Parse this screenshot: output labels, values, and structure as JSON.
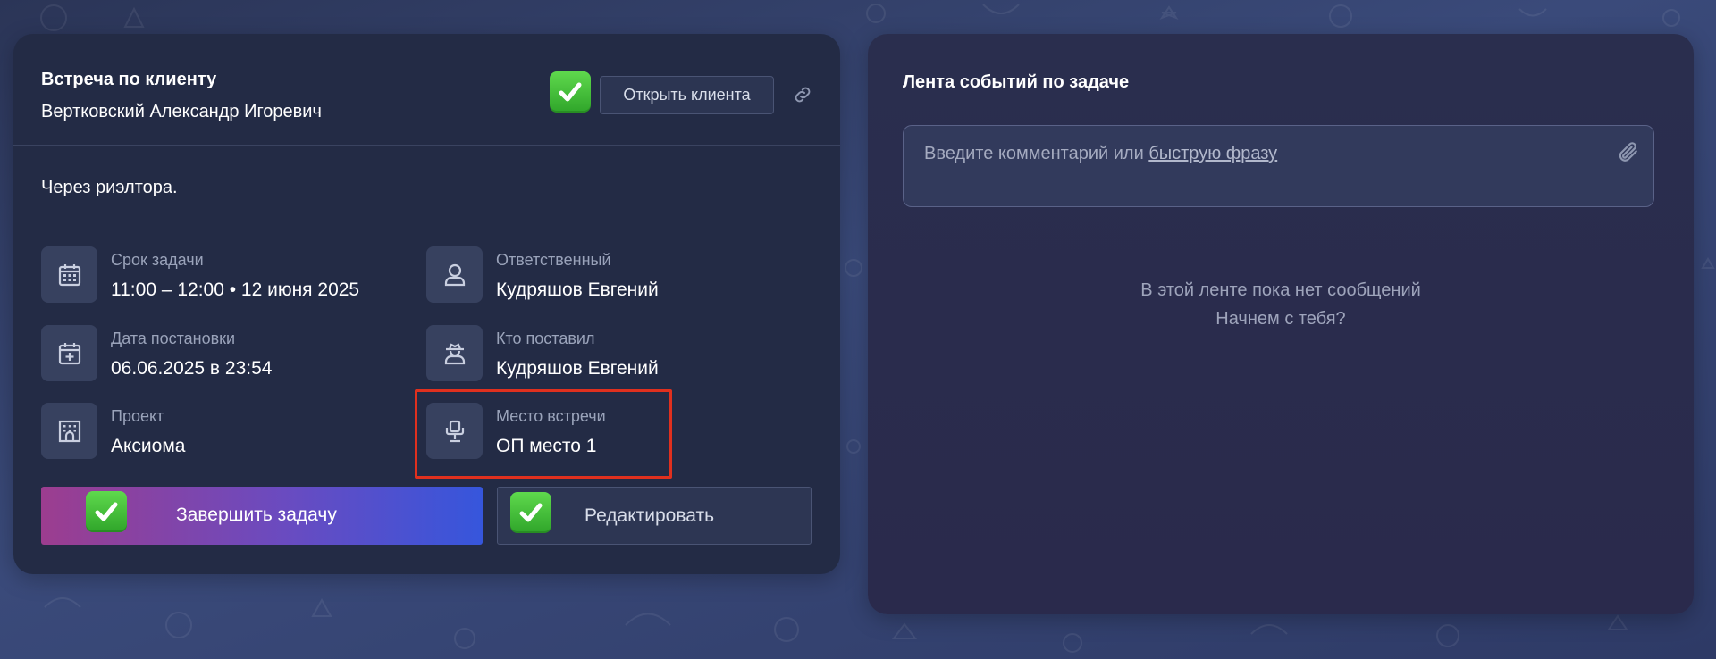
{
  "task": {
    "title": "Встреча по клиенту",
    "client_name": "Вертковский Александр Игоревич",
    "open_client_label": "Открыть клиента",
    "note": "Через риэлтора.",
    "fields": {
      "deadline": {
        "label": "Срок задачи",
        "value": "11:00 – 12:00 • 12 июня 2025",
        "icon": "calendar-icon"
      },
      "responsible": {
        "label": "Ответственный",
        "value": "Кудряшов Евгений",
        "icon": "user-icon"
      },
      "created": {
        "label": "Дата постановки",
        "value": "06.06.2025 в 23:54",
        "icon": "calendar-plus-icon"
      },
      "creator": {
        "label": "Кто поставил",
        "value": "Кудряшов Евгений",
        "icon": "agent-icon"
      },
      "project": {
        "label": "Проект",
        "value": "Аксиома",
        "icon": "building-icon"
      },
      "place": {
        "label": "Место встречи",
        "value": "ОП место 1",
        "icon": "chair-icon"
      }
    },
    "complete_label": "Завершить задачу",
    "edit_label": "Редактировать"
  },
  "feed": {
    "title": "Лента событий по задаче",
    "comment_placeholder": "Введите комментарий или ",
    "quick_phrase_link": "быструю фразу",
    "empty_line1": "В этой ленте пока нет сообщений",
    "empty_line2": "Начнем с тебя?"
  },
  "colors": {
    "highlight": "#e0301e",
    "check_green": "#3fbf37",
    "complete_gradient_start": "#9c3d8f",
    "complete_gradient_end": "#3656dc"
  }
}
